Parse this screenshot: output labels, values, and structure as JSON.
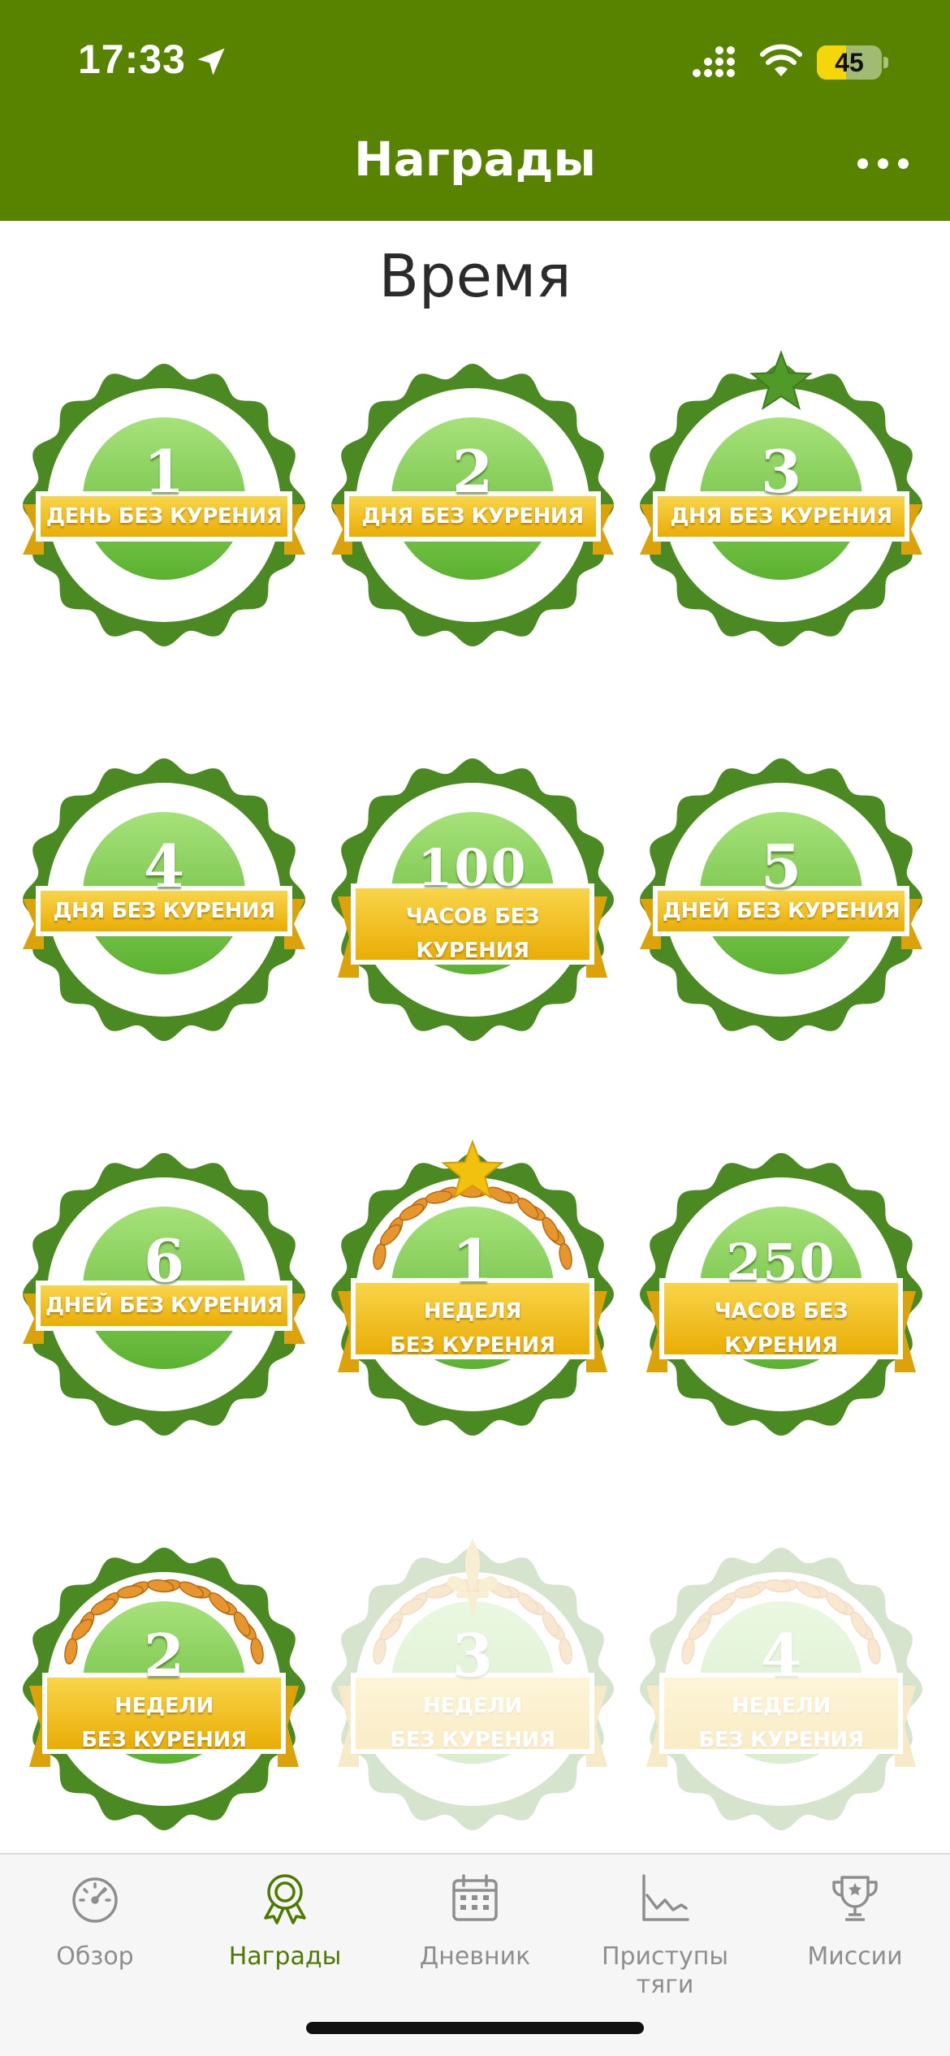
{
  "status": {
    "time": "17:33",
    "battery_level": "45",
    "battery_fraction": 0.45
  },
  "header": {
    "title": "Награды",
    "more_icon": "ellipsis-icon"
  },
  "section": {
    "title": "Время"
  },
  "badges": [
    {
      "number": "1",
      "label": "ДЕНЬ БЕЗ КУРЕНИЯ",
      "decoration": "none",
      "locked": false
    },
    {
      "number": "2",
      "label": "ДНЯ БЕЗ КУРЕНИЯ",
      "decoration": "none",
      "locked": false
    },
    {
      "number": "3",
      "label": "ДНЯ БЕЗ КУРЕНИЯ",
      "decoration": "star",
      "locked": false
    },
    {
      "number": "4",
      "label": "ДНЯ БЕЗ КУРЕНИЯ",
      "decoration": "none",
      "locked": false
    },
    {
      "number": "100",
      "label": "ЧАСОВ БЕЗ\nКУРЕНИЯ",
      "decoration": "none",
      "locked": false
    },
    {
      "number": "5",
      "label": "ДНЕЙ БЕЗ КУРЕНИЯ",
      "decoration": "none",
      "locked": false
    },
    {
      "number": "6",
      "label": "ДНЕЙ БЕЗ КУРЕНИЯ",
      "decoration": "none",
      "locked": false
    },
    {
      "number": "1",
      "label": "НЕДЕЛЯ\nБЕЗ КУРЕНИЯ",
      "decoration": "star-wreath",
      "locked": false
    },
    {
      "number": "250",
      "label": "ЧАСОВ БЕЗ\nКУРЕНИЯ",
      "decoration": "none",
      "locked": false
    },
    {
      "number": "2",
      "label": "НЕДЕЛИ\nБЕЗ КУРЕНИЯ",
      "decoration": "wreath",
      "locked": false
    },
    {
      "number": "3",
      "label": "НЕДЕЛИ\nБЕЗ КУРЕНИЯ",
      "decoration": "fleur-wreath",
      "locked": true
    },
    {
      "number": "4",
      "label": "НЕДЕЛИ\nБЕЗ КУРЕНИЯ",
      "decoration": "wreath",
      "locked": true
    }
  ],
  "tabs": [
    {
      "id": "overview",
      "label": "Обзор",
      "icon": "speedometer-icon",
      "active": false
    },
    {
      "id": "awards",
      "label": "Награды",
      "icon": "award-icon",
      "active": true
    },
    {
      "id": "diary",
      "label": "Дневник",
      "icon": "calendar-icon",
      "active": false
    },
    {
      "id": "cravings",
      "label": "Приступы тяги",
      "icon": "chart-icon",
      "active": false
    },
    {
      "id": "missions",
      "label": "Миссии",
      "icon": "trophy-icon",
      "active": false
    }
  ],
  "colors": {
    "header_bg": "#578300",
    "badge_dark_green": "#4b8a22",
    "badge_light_green": "#a3df73",
    "ribbon_gold": "#f1c40f",
    "tab_active": "#4e7a00",
    "tab_inactive": "#8e8e8e"
  }
}
